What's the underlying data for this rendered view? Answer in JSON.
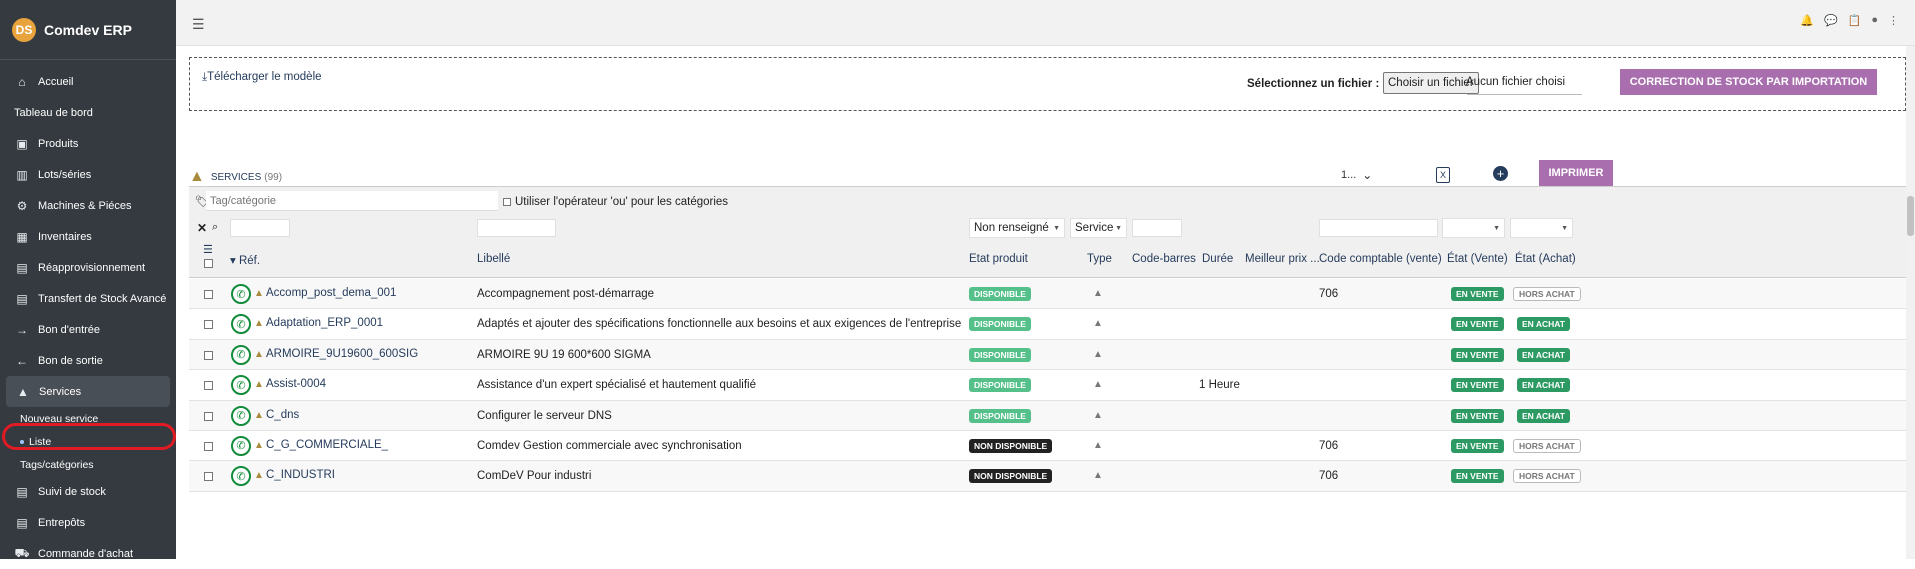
{
  "sidebar": {
    "brand": "Comdev ERP",
    "brand_logo": "DS",
    "items": [
      {
        "label": "Accueil",
        "icon": "home-icon"
      },
      {
        "label": "Tableau de bord"
      },
      {
        "label": "Produits",
        "icon": "box-icon"
      },
      {
        "label": "Lots/séries",
        "icon": "barcode-icon"
      },
      {
        "label": "Machines & Piéces",
        "icon": "cogs-icon"
      },
      {
        "label": "Inventaires",
        "icon": "boxes-icon"
      },
      {
        "label": "Réapprovisionnement",
        "icon": "warehouse-icon"
      },
      {
        "label": "Transfert de Stock Avancé",
        "icon": "warehouse-icon"
      },
      {
        "label": "Bon d'entrée",
        "icon": "arrow-right-icon"
      },
      {
        "label": "Bon de sortie",
        "icon": "arrow-left-icon"
      },
      {
        "label": "Services",
        "icon": "bell-icon"
      }
    ],
    "sub_items": [
      "Nouveau service",
      "Liste",
      "Tags/catégories"
    ],
    "bottom_items": [
      {
        "label": "Suivi de stock",
        "icon": "warehouse-icon"
      },
      {
        "label": "Entrepôts",
        "icon": "warehouse-icon"
      },
      {
        "label": "Commande d'achat",
        "icon": "dolly-icon"
      }
    ]
  },
  "import": {
    "download_link": "Télécharger le modèle",
    "file_label": "Sélectionnez un fichier :",
    "file_button": "Choisir un fichier",
    "file_status": "Aucun fichier choisi",
    "import_button": "CORRECTION DE STOCK PAR IMPORTATION"
  },
  "list": {
    "title": "SERVICES",
    "count": "(99)",
    "page_select": "1...",
    "print_button": "IMPRIMER"
  },
  "filters": {
    "tag_placeholder": "Tag/catégorie",
    "or_operator": "Utiliser l'opérateur 'ou' pour les catégories",
    "etat_select": "Non renseigné",
    "type_select": "Service"
  },
  "columns": [
    "Réf.",
    "Libellé",
    "Etat produit",
    "Type",
    "Code-barres",
    "Durée",
    "Meilleur prix ...",
    "Code comptable (vente)",
    "État (Vente)",
    "État (Achat)"
  ],
  "rows": [
    {
      "ref": "Accomp_post_dema_001",
      "label": "Accompagnement post-démarrage",
      "etat": "DISPONIBLE",
      "duree": "",
      "code": "706",
      "vente": "EN VENTE",
      "achat": "HORS ACHAT"
    },
    {
      "ref": "Adaptation_ERP_0001",
      "label": "Adaptés et ajouter des spécifications fonctionnelle aux besoins et aux exigences de l'entreprise",
      "etat": "DISPONIBLE",
      "duree": "",
      "code": "",
      "vente": "EN VENTE",
      "achat": "EN ACHAT"
    },
    {
      "ref": "ARMOIRE_9U19600_600SIG",
      "label": "ARMOIRE 9U 19 600*600 SIGMA",
      "etat": "DISPONIBLE",
      "duree": "",
      "code": "",
      "vente": "EN VENTE",
      "achat": "EN ACHAT"
    },
    {
      "ref": "Assist-0004",
      "label": "Assistance d'un expert spécialisé et hautement qualifié",
      "etat": "DISPONIBLE",
      "duree": "1 Heure",
      "code": "",
      "vente": "EN VENTE",
      "achat": "EN ACHAT"
    },
    {
      "ref": "C_dns",
      "label": "Configurer le serveur DNS",
      "etat": "DISPONIBLE",
      "duree": "",
      "code": "",
      "vente": "EN VENTE",
      "achat": "EN ACHAT"
    },
    {
      "ref": "C_G_COMMERCIALE_",
      "label": "Comdev Gestion commerciale avec synchronisation",
      "etat": "NON DISPONIBLE",
      "duree": "",
      "code": "706",
      "vente": "EN VENTE",
      "achat": "HORS ACHAT"
    },
    {
      "ref": "C_INDUSTRI",
      "label": "ComDeV Pour industri",
      "etat": "NON DISPONIBLE",
      "duree": "",
      "code": "706",
      "vente": "EN VENTE",
      "achat": "HORS ACHAT"
    }
  ]
}
